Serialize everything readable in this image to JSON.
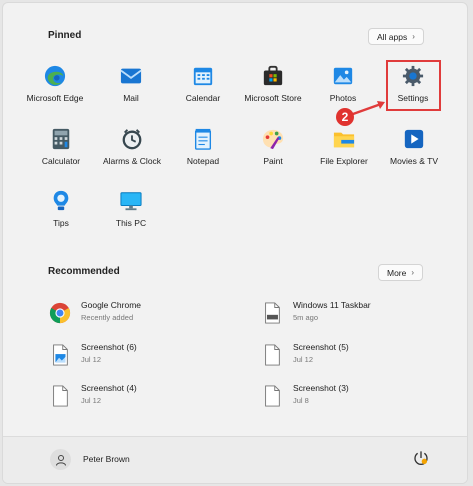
{
  "pinned": {
    "title": "Pinned",
    "all_apps_label": "All apps",
    "apps": [
      {
        "label": "Microsoft Edge",
        "icon": "edge-icon"
      },
      {
        "label": "Mail",
        "icon": "mail-icon"
      },
      {
        "label": "Calendar",
        "icon": "calendar-icon"
      },
      {
        "label": "Microsoft Store",
        "icon": "store-icon"
      },
      {
        "label": "Photos",
        "icon": "photos-icon"
      },
      {
        "label": "Settings",
        "icon": "gear-icon"
      },
      {
        "label": "Calculator",
        "icon": "calculator-icon"
      },
      {
        "label": "Alarms & Clock",
        "icon": "clock-icon"
      },
      {
        "label": "Notepad",
        "icon": "notepad-icon"
      },
      {
        "label": "Paint",
        "icon": "paint-icon"
      },
      {
        "label": "File Explorer",
        "icon": "folder-icon"
      },
      {
        "label": "Movies & TV",
        "icon": "movies-icon"
      },
      {
        "label": "Tips",
        "icon": "tips-icon"
      },
      {
        "label": "This PC",
        "icon": "monitor-icon"
      }
    ]
  },
  "annotation": {
    "step": "2",
    "color": "#e0332f"
  },
  "recommended": {
    "title": "Recommended",
    "more_label": "More",
    "items": [
      {
        "name": "Google Chrome",
        "sub": "Recently added",
        "icon": "chrome-icon"
      },
      {
        "name": "Windows 11 Taskbar",
        "sub": "5m ago",
        "icon": "document-icon"
      },
      {
        "name": "Screenshot (6)",
        "sub": "Jul 12",
        "icon": "image-file-icon"
      },
      {
        "name": "Screenshot (5)",
        "sub": "Jul 12",
        "icon": "file-icon"
      },
      {
        "name": "Screenshot (4)",
        "sub": "Jul 12",
        "icon": "file-icon"
      },
      {
        "name": "Screenshot (3)",
        "sub": "Jul 8",
        "icon": "file-icon"
      }
    ]
  },
  "user": {
    "name": "Peter Brown"
  },
  "colors": {
    "accent": "#0067c0",
    "highlight": "#e03b3b",
    "background": "#f2f2f2"
  }
}
